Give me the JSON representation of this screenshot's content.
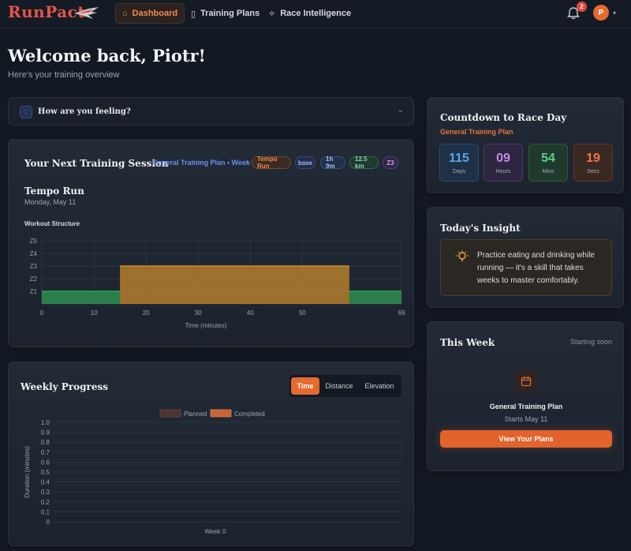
{
  "brand": {
    "name": "RunPact"
  },
  "nav": {
    "items": [
      {
        "label": "Dashboard",
        "icon": "home-icon",
        "active": true
      },
      {
        "label": "Training Plans",
        "icon": "clipboard-icon",
        "active": false
      },
      {
        "label": "Race Intelligence",
        "icon": "sparkle-icon",
        "active": false
      }
    ],
    "notifications_count": "2",
    "avatar_initial": "P"
  },
  "header": {
    "title": "Welcome back, Piotr!",
    "subtitle": "Here's your training overview"
  },
  "feeling": {
    "label": "How are you feeling?"
  },
  "next_session": {
    "title": "Your Next Training Session",
    "plan_link": "General Training Plan • Week 1",
    "pills": [
      "Tempo Run",
      "base",
      "1h 9m",
      "12.5 km",
      "Z3"
    ],
    "session_name": "Tempo Run",
    "session_date": "Monday, May 11",
    "structure_label": "Workout Structure"
  },
  "chart_data": [
    {
      "type": "step-area",
      "title": "Workout Structure",
      "xlabel": "Time (minutes)",
      "ylabel": "",
      "x_ticks": [
        0,
        10,
        20,
        30,
        40,
        50,
        69
      ],
      "y_ticks": [
        "Z1",
        "Z2",
        "Z3",
        "Z4",
        "Z5"
      ],
      "xlim": [
        0,
        69
      ],
      "ylim": [
        0,
        5
      ],
      "segments": [
        {
          "start": 0,
          "end": 15,
          "zone": 1,
          "color": "#2f9e55"
        },
        {
          "start": 15,
          "end": 59,
          "zone": 3,
          "color": "#c98a2c"
        },
        {
          "start": 59,
          "end": 69,
          "zone": 1,
          "color": "#2f9e55"
        }
      ],
      "grid": true
    },
    {
      "type": "bar",
      "title": "Weekly Progress",
      "categories": [
        "Week 0"
      ],
      "series": [
        {
          "name": "Planned",
          "values": [
            0
          ],
          "color": "#4a3532"
        },
        {
          "name": "Completed",
          "values": [
            0
          ],
          "color": "#c8643a"
        }
      ],
      "xlabel": "",
      "ylabel": "Duration (minutes)",
      "ylim": [
        0,
        1
      ],
      "y_ticks": [
        "0",
        "0.1",
        "0.2",
        "0.3",
        "0.4",
        "0.5",
        "0.6",
        "0.7",
        "0.8",
        "0.9",
        "1.0"
      ],
      "legend": "top",
      "grid": true
    }
  ],
  "weekly": {
    "title": "Weekly Progress",
    "tabs": [
      {
        "label": "Time",
        "active": true
      },
      {
        "label": "Distance",
        "active": false
      },
      {
        "label": "Elevation",
        "active": false
      }
    ]
  },
  "countdown": {
    "title": "Countdown to Race Day",
    "plan": "General Training Plan",
    "units": [
      {
        "value": "115",
        "label": "Days",
        "color": "#5aa4f0",
        "bg": "#1f3146",
        "border": "#2e4a6a"
      },
      {
        "value": "09",
        "label": "Hours",
        "color": "#c68ae8",
        "bg": "#2e2640",
        "border": "#4a3a66"
      },
      {
        "value": "54",
        "label": "Mins",
        "color": "#5cd08a",
        "bg": "#1f3a2c",
        "border": "#2e5a40"
      },
      {
        "value": "19",
        "label": "Secs",
        "color": "#f07a3a",
        "bg": "#3a2822",
        "border": "#5a3a2c"
      }
    ]
  },
  "insight": {
    "title": "Today's Insight",
    "text": "Practice eating and drinking while running — it's a skill that takes weeks to master comfortably.",
    "icon": "lightbulb-icon"
  },
  "this_week": {
    "title": "This Week",
    "status": "Starting soon",
    "plan": "General Training Plan",
    "starts": "Starts May 11",
    "button": "View Your Plans",
    "icon": "calendar-icon"
  },
  "colors": {
    "accent": "#e46a2e",
    "background": "#131923"
  }
}
